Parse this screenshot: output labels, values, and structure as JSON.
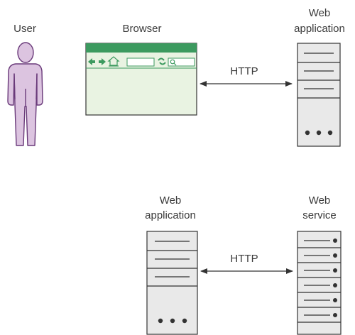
{
  "top": {
    "user_label": "User",
    "browser_label": "Browser",
    "server_label_line1": "Web",
    "server_label_line2": "application",
    "protocol_label": "HTTP"
  },
  "bottom": {
    "app_label_line1": "Web",
    "app_label_line2": "application",
    "service_label_line1": "Web",
    "service_label_line2": "service",
    "protocol_label": "HTTP"
  },
  "icons": [
    "user-figure-icon",
    "browser-window-icon",
    "server-icon",
    "arrow-left-icon",
    "arrow-right-icon",
    "home-icon",
    "refresh-icon",
    "search-icon"
  ],
  "colors": {
    "person_fill": "#dcc4e0",
    "person_stroke": "#6a3a7a",
    "browser_bar": "#3c9a5f",
    "browser_body": "#e9f3e2",
    "server_fill": "#e9e9e9",
    "line": "#333333"
  }
}
